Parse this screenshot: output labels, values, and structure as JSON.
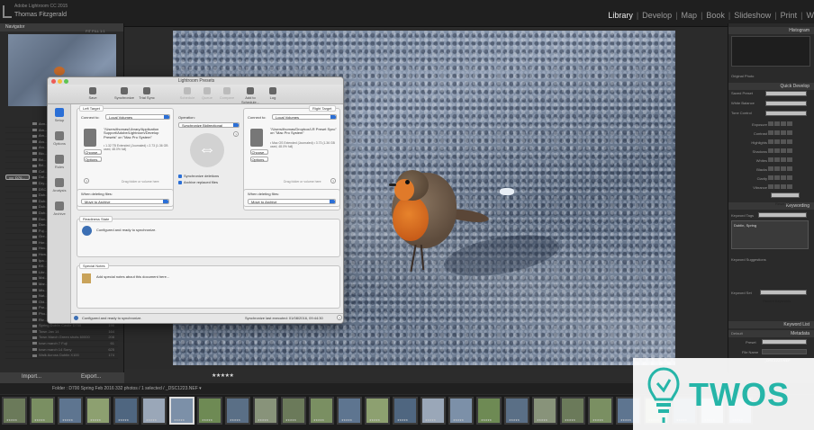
{
  "app": {
    "name": "Adobe Lightroom CC 2015",
    "user": "Thomas Fitzgerald"
  },
  "modules": [
    "Library",
    "Develop",
    "Map",
    "Book",
    "Slideshow",
    "Print",
    "W"
  ],
  "active_module": "Library",
  "left_panel": {
    "navigator_label": "Navigator",
    "navigator_tools": "FIT  FILL  1:1",
    "folders": [
      {
        "name": "Ann...",
        "count": "",
        "dim": false
      },
      {
        "name": "Am...",
        "count": "",
        "dim": false
      },
      {
        "name": "Am...",
        "count": "",
        "dim": false
      },
      {
        "name": "Aro...",
        "count": "",
        "dim": false
      },
      {
        "name": "Aro...",
        "count": "",
        "dim": false
      },
      {
        "name": "Blo...",
        "count": "",
        "dim": false
      },
      {
        "name": "Bri...",
        "count": "",
        "dim": false
      },
      {
        "name": "Bri...",
        "count": "",
        "dim": false
      },
      {
        "name": "Cof...",
        "count": "",
        "dim": false
      },
      {
        "name": "D70...",
        "count": "",
        "selected": true
      },
      {
        "name": "Dal...",
        "count": "",
        "dim": false
      },
      {
        "name": "Dry...",
        "count": "",
        "dim": false
      },
      {
        "name": "DSC...",
        "count": "",
        "dim": false
      },
      {
        "name": "Dub...",
        "count": "",
        "dim": false
      },
      {
        "name": "Dub...",
        "count": "",
        "dim": false
      },
      {
        "name": "Dub...",
        "count": "",
        "dim": false
      },
      {
        "name": "Dub...",
        "count": "",
        "dim": false
      },
      {
        "name": "Dun...",
        "count": "",
        "dim": false
      },
      {
        "name": "Dun...",
        "count": "",
        "dim": false
      },
      {
        "name": "Fuj...",
        "count": "",
        "dim": false
      },
      {
        "name": "Gre...",
        "count": "",
        "dim": false
      },
      {
        "name": "Hor...",
        "count": "",
        "dim": false
      },
      {
        "name": "Hou...",
        "count": "",
        "dim": false
      },
      {
        "name": "How...",
        "count": "",
        "dim": false
      },
      {
        "name": "Ipa...",
        "count": "",
        "dim": false
      },
      {
        "name": "Kill...",
        "count": "",
        "dim": false
      },
      {
        "name": "Libr...",
        "count": "",
        "dim": false
      },
      {
        "name": "Mal...",
        "count": "",
        "dim": false
      },
      {
        "name": "Mar...",
        "count": "",
        "dim": false
      },
      {
        "name": "Mis...",
        "count": "",
        "dim": false
      },
      {
        "name": "Nat...",
        "count": "",
        "dim": false
      },
      {
        "name": "Old...",
        "count": "",
        "dim": false
      },
      {
        "name": "Par...",
        "count": "",
        "dim": false
      },
      {
        "name": "Pho...",
        "count": "",
        "dim": false
      },
      {
        "name": "Riv...",
        "count": "",
        "dim": false
      },
      {
        "name": "Spring Dublin Castle D700",
        "count": "190",
        "dim": true
      },
      {
        "name": "Town Jan 14",
        "count": "164",
        "dim": true
      },
      {
        "name": "Town March Green shots 60000",
        "count": "208",
        "dim": true
      },
      {
        "name": "town march 7 Fuji",
        "count": "61",
        "dim": true
      },
      {
        "name": "town march 14 Sony",
        "count": "625",
        "dim": true
      },
      {
        "name": "Walk Across Dublin X100",
        "count": "174",
        "dim": true
      }
    ],
    "import_label": "Import...",
    "export_label": "Export..."
  },
  "right_panel": {
    "histogram_label": "Histogram",
    "original_photo": "Original Photo",
    "quick_develop_label": "Quick Develop",
    "saved_preset_label": "Saved Preset",
    "saved_preset_value": "Custom",
    "white_balance_label": "White Balance",
    "white_balance_value": "As Shot",
    "tone_control_label": "Tone Control",
    "tone_control_value": "Auto Tone",
    "tone_rows": [
      "Exposure",
      "Contrast",
      "Highlights",
      "Shadows",
      "Whites",
      "Blacks",
      "Clarity",
      "Vibrance"
    ],
    "reset_all": "Reset All",
    "keywording_label": "Keywording",
    "keyword_tags_label": "Keyword Tags",
    "keyword_tags_value": "Enter Keywords",
    "keywords_text": "Dublin, Spring",
    "keyword_suggestions_label": "Keyword Suggestions",
    "keyword_set_label": "Keyword Set",
    "keyword_set_value": "Recent Keywords",
    "keyword_list_label": "Keyword List",
    "metadata_label": "Metadata",
    "metadata_preset_value": "Default",
    "preset_label": "Preset",
    "preset_value": "None",
    "file_name_label": "File Name",
    "file_name_value": "_DSC1223.NEF"
  },
  "filmstrip": {
    "path": "Folder : D700 Spring Feb 2016     332 photos / 1 selected / _DSC1223.NEF ▾",
    "stars": "★★★★★",
    "thumb_count": 27,
    "selected_index": 6
  },
  "dialog": {
    "title": "Lightroom Presets",
    "toolbar": [
      {
        "label": "Save",
        "disabled": false
      },
      {
        "label": "Synchronize",
        "disabled": false
      },
      {
        "label": "Trial Sync",
        "disabled": false
      },
      {
        "label": "Schedule",
        "disabled": true
      },
      {
        "label": "Queue",
        "disabled": true
      },
      {
        "label": "Compare",
        "disabled": true
      },
      {
        "label": "Add to Schedule...",
        "disabled": false
      },
      {
        "label": "Log",
        "disabled": false
      }
    ],
    "sidebar": [
      "Setup",
      "Options",
      "Rules",
      "Analysis",
      "Archive"
    ],
    "left_target": {
      "title": "Left Target",
      "connect_label": "Connect to:",
      "connect_value": "Local Volumes",
      "path": "\"/Users/thomas/Library/Application Support/Adobe/Lightroom/Develop Presets\" on \"Mac Pro System\"",
      "info": "• 1.32 TB Extended (Journaled) • 2.73 (1.36 GB used, 48.0% full)",
      "choose": "Choose...",
      "options": "Options...",
      "drop_hint": "Drag folder or volume here",
      "deleting_label": "When deleting files:",
      "deleting_value": "Move to Archive"
    },
    "operation": {
      "label": "Operation:",
      "value": "Synchronize Bidirectional",
      "sync_deletions": "Synchronize deletions",
      "archive_replaced": "Archive replaced files"
    },
    "right_target": {
      "title": "Right Target",
      "connect_label": "Connect to:",
      "connect_value": "Local Volumes",
      "path": "\"/Users/thomas/Dropbox/LR Preset Sync\" on \"Mac Pro System\"",
      "info": "• Mac OS Extended (Journaled) • 3.73 (1.36 GB used, 48.0% full)",
      "choose": "Choose...",
      "options": "Options...",
      "drop_hint": "Drag folder or volume here",
      "deleting_label": "When deleting files:",
      "deleting_value": "Move to Archive"
    },
    "readiness_title": "Readiness State",
    "readiness_text": "Configured and ready to synchronize.",
    "notes_title": "Special Notes",
    "notes_text": "Add special notes about this document here...",
    "status_left": "Configured and ready to synchronize.",
    "status_right": "Synchronize last executed: 01/08/2016, 09:44:30"
  },
  "watermark": {
    "text": "TWOS"
  }
}
